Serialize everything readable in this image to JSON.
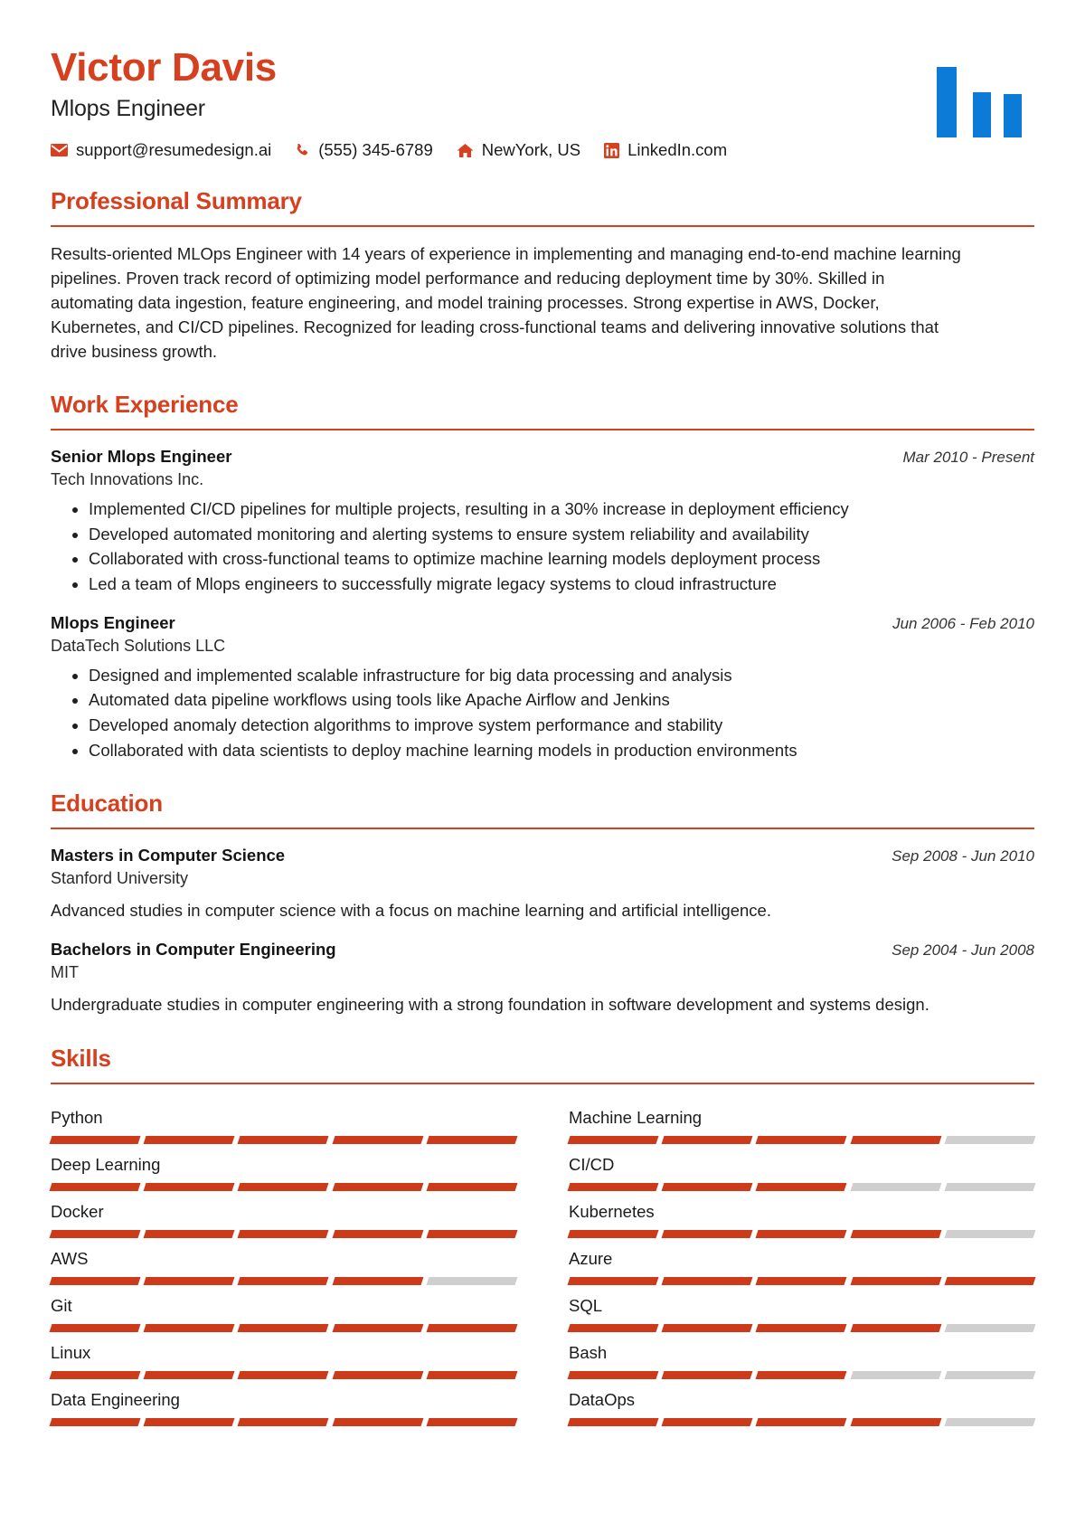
{
  "theme": {
    "accent": "#d6401e",
    "logo_blue": "#0c7bd8",
    "bar_filled": "#cc3a19",
    "bar_empty": "#cfcfcf"
  },
  "header": {
    "name": "Victor Davis",
    "title": "Mlops Engineer",
    "contacts": [
      {
        "icon": "envelope-icon",
        "text": "support@resumedesign.ai"
      },
      {
        "icon": "phone-icon",
        "text": "(555) 345-6789"
      },
      {
        "icon": "home-icon",
        "text": "NewYork, US"
      },
      {
        "icon": "linkedin-icon",
        "text": "LinkedIn.com"
      }
    ]
  },
  "summary": {
    "heading": "Professional Summary",
    "text": "Results-oriented MLOps Engineer with 14 years of experience in implementing and managing end-to-end machine learning pipelines. Proven track record of optimizing model performance and reducing deployment time by 30%. Skilled in automating data ingestion, feature engineering, and model training processes. Strong expertise in AWS, Docker, Kubernetes, and CI/CD pipelines. Recognized for leading cross-functional teams and delivering innovative solutions that drive business growth."
  },
  "work": {
    "heading": "Work Experience",
    "entries": [
      {
        "role": "Senior Mlops Engineer",
        "org": "Tech Innovations Inc.",
        "dates": "Mar 2010 - Present",
        "bullets": [
          "Implemented CI/CD pipelines for multiple projects, resulting in a 30% increase in deployment efficiency",
          "Developed automated monitoring and alerting systems to ensure system reliability and availability",
          "Collaborated with cross-functional teams to optimize machine learning models deployment process",
          "Led a team of Mlops engineers to successfully migrate legacy systems to cloud infrastructure"
        ]
      },
      {
        "role": "Mlops Engineer",
        "org": "DataTech Solutions LLC",
        "dates": "Jun 2006 - Feb 2010",
        "bullets": [
          "Designed and implemented scalable infrastructure for big data processing and analysis",
          "Automated data pipeline workflows using tools like Apache Airflow and Jenkins",
          "Developed anomaly detection algorithms to improve system performance and stability",
          "Collaborated with data scientists to deploy machine learning models in production environments"
        ]
      }
    ]
  },
  "education": {
    "heading": "Education",
    "entries": [
      {
        "degree": "Masters in Computer Science",
        "school": "Stanford University",
        "dates": "Sep 2008 - Jun 2010",
        "description": "Advanced studies in computer science with a focus on machine learning and artificial intelligence."
      },
      {
        "degree": "Bachelors in Computer Engineering",
        "school": "MIT",
        "dates": "Sep 2004 - Jun 2008",
        "description": "Undergraduate studies in computer engineering with a strong foundation in software development and systems design."
      }
    ]
  },
  "skills": {
    "heading": "Skills",
    "segments_total": 5,
    "items": [
      {
        "name": "Python",
        "filled": 5
      },
      {
        "name": "Machine Learning",
        "filled": 4
      },
      {
        "name": "Deep Learning",
        "filled": 5
      },
      {
        "name": "CI/CD",
        "filled": 3
      },
      {
        "name": "Docker",
        "filled": 5
      },
      {
        "name": "Kubernetes",
        "filled": 4
      },
      {
        "name": "AWS",
        "filled": 4
      },
      {
        "name": "Azure",
        "filled": 5
      },
      {
        "name": "Git",
        "filled": 5
      },
      {
        "name": "SQL",
        "filled": 4
      },
      {
        "name": "Linux",
        "filled": 5
      },
      {
        "name": "Bash",
        "filled": 3
      },
      {
        "name": "Data Engineering",
        "filled": 5
      },
      {
        "name": "DataOps",
        "filled": 4
      }
    ]
  }
}
